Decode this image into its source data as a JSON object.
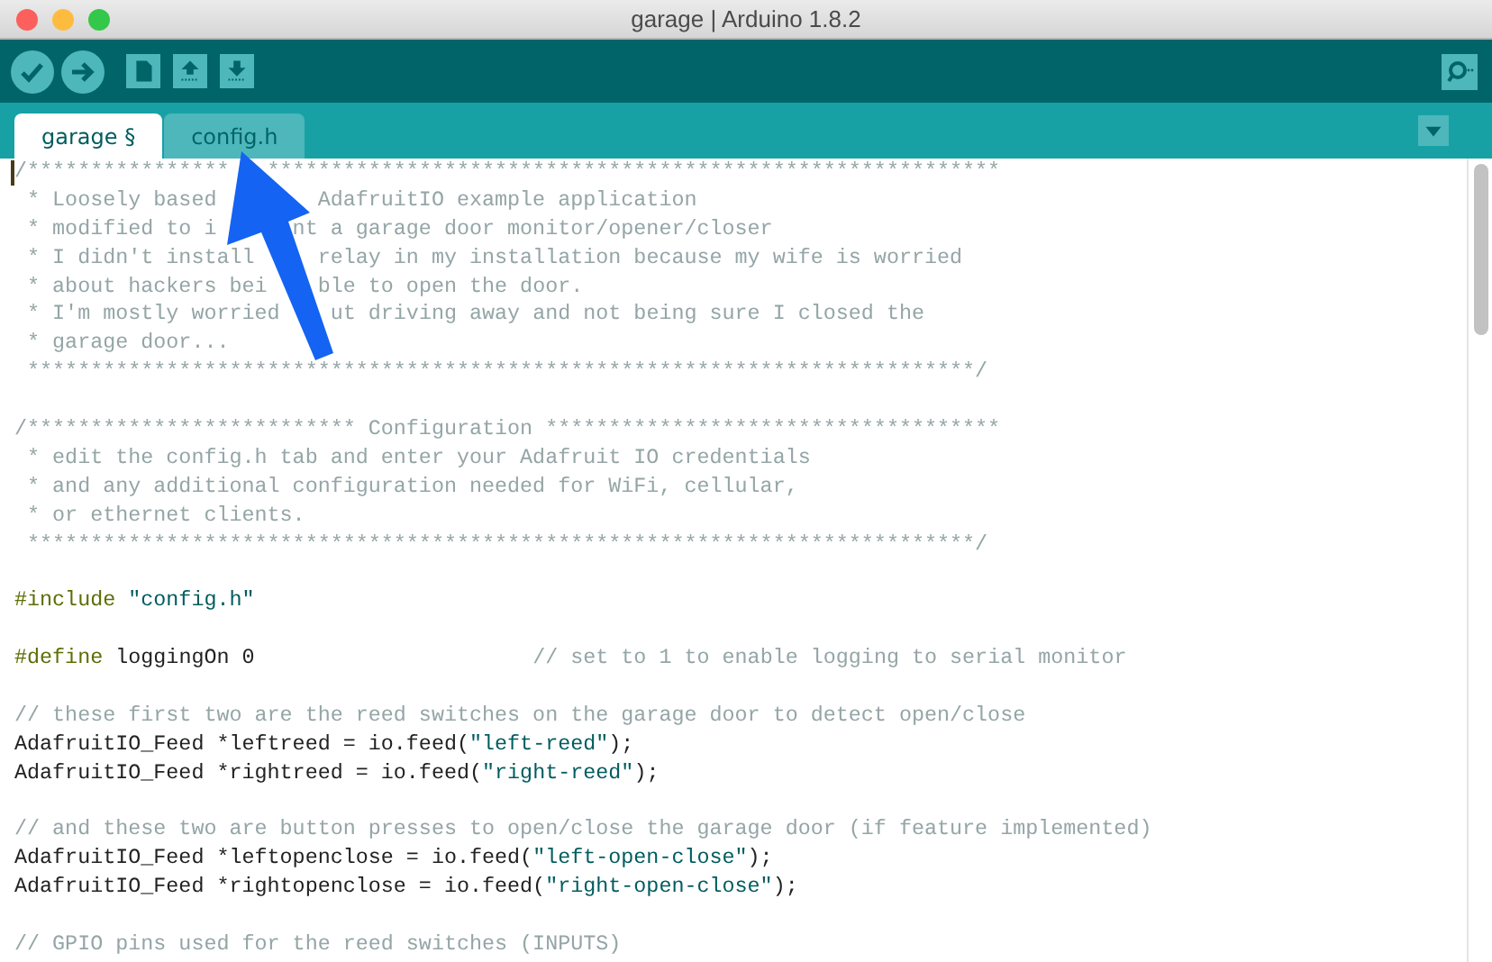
{
  "window": {
    "title": "garage | Arduino 1.8.2"
  },
  "tabs": [
    {
      "label": "garage §",
      "selected": true
    },
    {
      "label": "config.h",
      "selected": false
    }
  ],
  "code_blocks": [
    [
      [
        {
          "kind": "comment",
          "text": "/****************"
        },
        {
          "kind": "comment",
          "text": "   **********************************************************"
        }
      ],
      [
        {
          "kind": "comment",
          "text": " * Loosely based"
        },
        {
          "kind": "comment",
          "text": "        AdafruitIO example application"
        }
      ],
      [
        {
          "kind": "comment",
          "text": " * modified to i"
        },
        {
          "kind": "comment",
          "text": "      nt a garage door monitor/opener/closer"
        }
      ],
      [
        {
          "kind": "comment",
          "text": " * I didn't install"
        },
        {
          "kind": "comment",
          "text": "     relay in my installation because my wife is worried"
        }
      ],
      [
        {
          "kind": "comment",
          "text": " * about hackers bei"
        },
        {
          "kind": "comment",
          "text": "    ble to open the door."
        }
      ],
      [
        {
          "kind": "comment",
          "text": " * I'm mostly worried"
        },
        {
          "kind": "comment",
          "text": "    ut driving away and not being sure I closed the"
        }
      ],
      [
        {
          "kind": "comment",
          "text": " * garage door..."
        }
      ],
      [
        {
          "kind": "comment",
          "text": " ***************************************************************************/"
        }
      ]
    ],
    [
      [
        {
          "kind": "comment",
          "text": "/************************** Configuration ************************************"
        }
      ],
      [
        {
          "kind": "comment",
          "text": " * edit the config.h tab and enter your Adafruit IO credentials"
        }
      ],
      [
        {
          "kind": "comment",
          "text": " * and any additional configuration needed for WiFi, cellular,"
        }
      ],
      [
        {
          "kind": "comment",
          "text": " * or ethernet clients."
        }
      ],
      [
        {
          "kind": "comment",
          "text": " ***************************************************************************/"
        }
      ]
    ],
    [
      [
        {
          "kind": "preproc",
          "text": "#include "
        },
        {
          "kind": "string",
          "text": "\"config.h\""
        }
      ]
    ],
    [
      [
        {
          "kind": "preproc",
          "text": "#define"
        },
        {
          "kind": "plain",
          "text": " loggingOn 0                      "
        },
        {
          "kind": "comment",
          "text": "// set to 1 to enable logging to serial monitor"
        }
      ]
    ],
    [
      [
        {
          "kind": "comment",
          "text": "// these first two are the reed switches on the garage door to detect open/close"
        }
      ],
      [
        {
          "kind": "plain",
          "text": "AdafruitIO_Feed *leftreed = io.feed("
        },
        {
          "kind": "string",
          "text": "\"left-reed\""
        },
        {
          "kind": "plain",
          "text": ");"
        }
      ],
      [
        {
          "kind": "plain",
          "text": "AdafruitIO_Feed *rightreed = io.feed("
        },
        {
          "kind": "string",
          "text": "\"right-reed\""
        },
        {
          "kind": "plain",
          "text": ");"
        }
      ]
    ],
    [
      [
        {
          "kind": "comment",
          "text": "// and these two are button presses to open/close the garage door (if feature implemented)"
        }
      ],
      [
        {
          "kind": "plain",
          "text": "AdafruitIO_Feed *leftopenclose = io.feed("
        },
        {
          "kind": "string",
          "text": "\"left-open-close\""
        },
        {
          "kind": "plain",
          "text": ");"
        }
      ],
      [
        {
          "kind": "plain",
          "text": "AdafruitIO_Feed *rightopenclose = io.feed("
        },
        {
          "kind": "string",
          "text": "\"right-open-close\""
        },
        {
          "kind": "plain",
          "text": ");"
        }
      ]
    ],
    [
      [
        {
          "kind": "comment",
          "text": "// GPIO pins used for the reed switches (INPUTS)"
        }
      ]
    ]
  ]
}
